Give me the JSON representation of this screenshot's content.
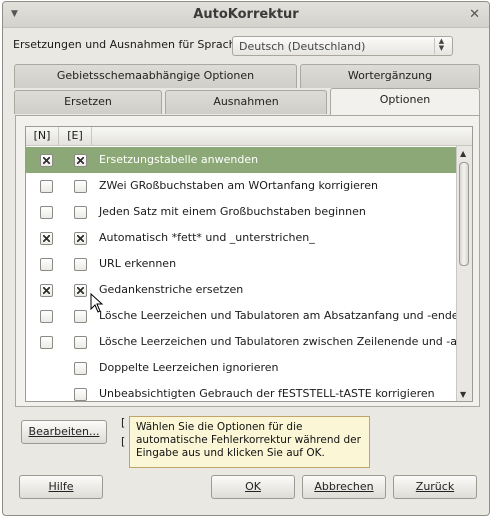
{
  "window": {
    "title": "AutoKorrektur"
  },
  "language": {
    "label": "Ersetzungen und Ausnahmen für Sprache:",
    "selected": "Deutsch (Deutschland)"
  },
  "tabs": {
    "row1": [
      "Gebietsschemaabhängige Optionen",
      "Wortergänzung"
    ],
    "row2": [
      "Ersetzen",
      "Ausnahmen",
      "Optionen"
    ],
    "active": "Optionen"
  },
  "list": {
    "columns": [
      "[N]",
      "[E]"
    ],
    "rows": [
      {
        "label": "Ersetzungstabelle anwenden",
        "n": true,
        "e": true,
        "selected": true
      },
      {
        "label": "ZWei GRoßbuchstaben am WOrtanfang korrigieren",
        "n": false,
        "e": false
      },
      {
        "label": "Jeden Satz mit einem Großbuchstaben beginnen",
        "n": false,
        "e": false
      },
      {
        "label": "Automatisch *fett* und _unterstrichen_",
        "n": true,
        "e": true
      },
      {
        "label": "URL erkennen",
        "n": false,
        "e": false
      },
      {
        "label": "Gedankenstriche ersetzen",
        "n": true,
        "e": true
      },
      {
        "label": "Lösche Leerzeichen und Tabulatoren am Absatzanfang und -ende",
        "n": false,
        "e": false
      },
      {
        "label": "Lösche Leerzeichen und Tabulatoren zwischen Zeilenende und -anfang",
        "n": false,
        "e": false
      },
      {
        "label": "Doppelte Leerzeichen ignorieren",
        "n": null,
        "e": false
      },
      {
        "label": "Unbeabsichtigten Gebrauch der fESTSTELL-tASTE korrigieren",
        "n": null,
        "e": false
      }
    ]
  },
  "edit_button": "Bearbeiten...",
  "tooltip": "Wählen Sie die Optionen für die automatische Fehlerkorrektur während der Eingabe aus und klicken Sie auf OK.",
  "buttons": {
    "help": "Hilfe",
    "ok": "OK",
    "cancel": "Abbrechen",
    "back": "Zurück"
  },
  "colors": {
    "selection": "#8ba876",
    "tooltip_bg": "#fbf6d6"
  }
}
